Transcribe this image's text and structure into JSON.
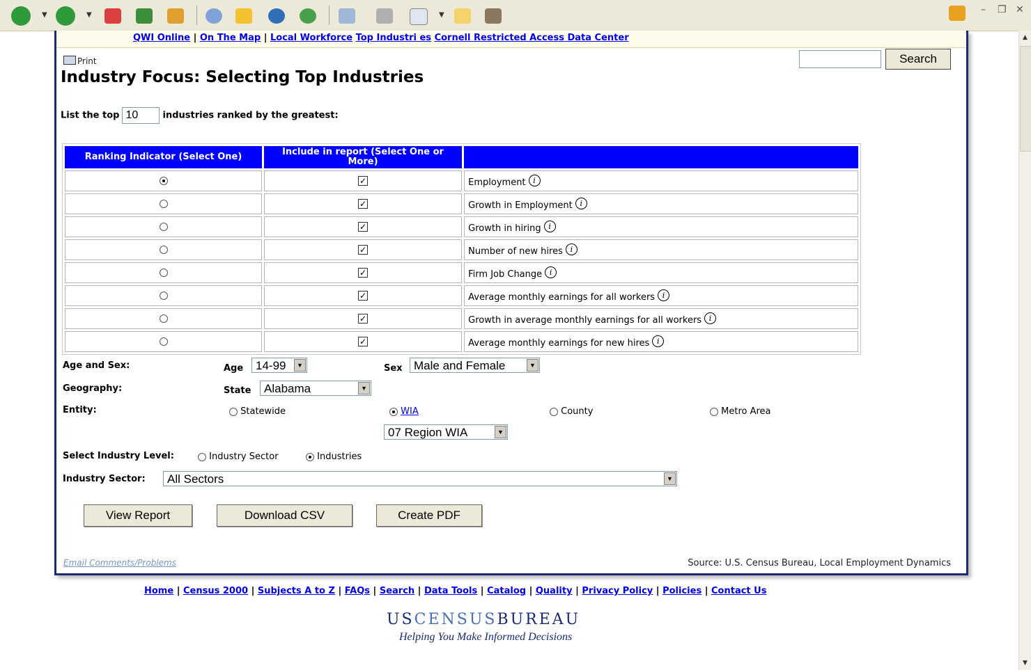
{
  "topnav": {
    "qwi": "QWI Online",
    "otm": "On The Map",
    "local": "Local Workforce",
    "top": "Top Industri es",
    "cornell": "Cornell Restricted Access Data Center"
  },
  "print_label": "Print",
  "search_button": "Search",
  "page_title": "Industry Focus: Selecting Top Industries",
  "toplist": {
    "prefix": "List the top",
    "value": "10",
    "suffix": "industries ranked by the greatest:"
  },
  "table": {
    "headers": [
      "Ranking Indicator (Select One)",
      "Include in report (Select One or More)",
      ""
    ],
    "rows": [
      {
        "label": "Employment",
        "selected": true,
        "checked": true
      },
      {
        "label": "Growth in Employment",
        "selected": false,
        "checked": true
      },
      {
        "label": "Growth in hiring",
        "selected": false,
        "checked": true
      },
      {
        "label": "Number of new hires",
        "selected": false,
        "checked": true
      },
      {
        "label": "Firm Job Change",
        "selected": false,
        "checked": true
      },
      {
        "label": "Average monthly earnings for all workers",
        "selected": false,
        "checked": true
      },
      {
        "label": "Growth in average monthly earnings for all workers",
        "selected": false,
        "checked": true
      },
      {
        "label": "Average monthly earnings for new hires",
        "selected": false,
        "checked": true
      }
    ]
  },
  "form": {
    "age_sex_label": "Age and Sex:",
    "age_label": "Age",
    "age_value": "14-99",
    "sex_label": "Sex",
    "sex_value": "Male and Female",
    "geography_label": "Geography:",
    "state_label": "State",
    "state_value": "Alabama",
    "entity_label": "Entity:",
    "entity_statewide": "Statewide",
    "entity_wia": "WIA",
    "entity_county": "County",
    "entity_metro": "Metro Area",
    "wia_value": "07 Region WIA",
    "industry_level_label": "Select Industry Level:",
    "level_sector": "Industry Sector",
    "level_industries": "Industries",
    "sector_label": "Industry Sector:",
    "sector_value": "All Sectors"
  },
  "buttons": {
    "view": "View Report",
    "csv": "Download CSV",
    "pdf": "Create PDF"
  },
  "email": "Email Comments/Problems",
  "source": "Source: U.S. Census Bureau, Local Employment Dynamics",
  "footnav": [
    "Home",
    "Census 2000",
    "Subjects A to Z",
    "FAQs",
    "Search",
    "Data Tools",
    "Catalog",
    "Quality",
    "Privacy Policy",
    "Policies",
    "Contact Us"
  ],
  "logo": {
    "dark": "US",
    "light": "CENSUS",
    "dark2": "BUREAU"
  },
  "tagline": "Helping You Make Informed Decisions",
  "colors": {
    "header_blue": "#0000ff",
    "frame_navy": "#1b2a73",
    "link": "#0000ee"
  }
}
